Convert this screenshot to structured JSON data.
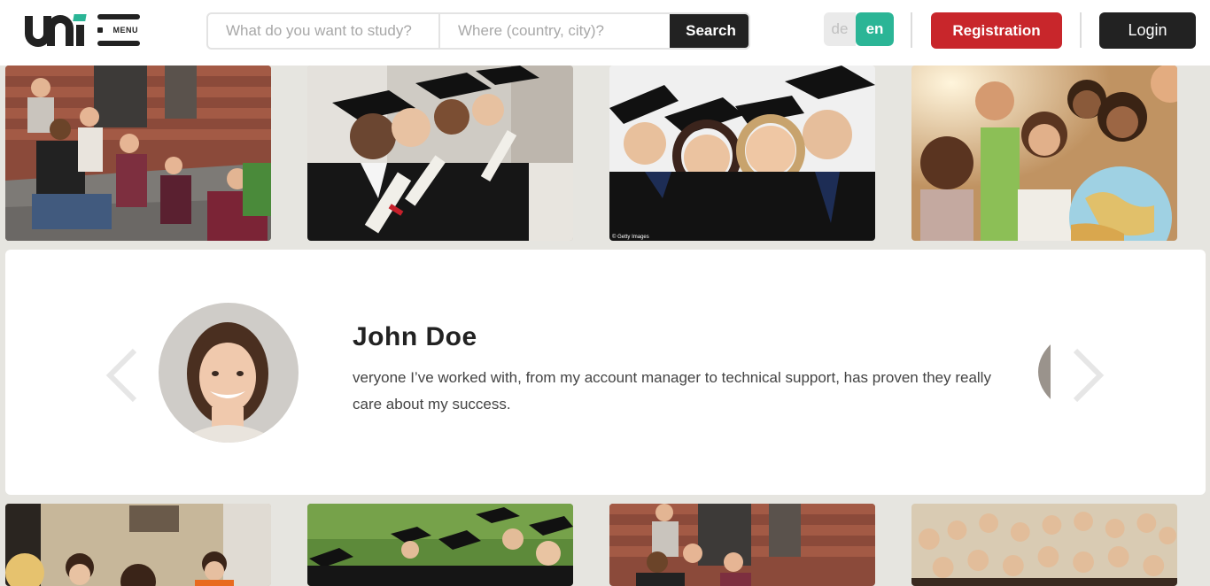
{
  "header": {
    "logo_alt": "uni",
    "menu_label": "MENU",
    "search": {
      "what_placeholder": "What do you want to study?",
      "where_placeholder": "Where (country, city)?",
      "button_label": "Search"
    },
    "languages": [
      "de",
      "en"
    ],
    "active_language": "en",
    "registration_label": "Registration",
    "login_label": "Login"
  },
  "gallery_top": [
    {
      "caption": "Students sitting on steps"
    },
    {
      "caption": "Graduates holding diplomas"
    },
    {
      "caption": "Graduates smiling",
      "credit": "© Getty Images"
    },
    {
      "caption": "Students looking at a globe"
    }
  ],
  "testimonial": {
    "name": "John Doe",
    "text": "veryone I’ve worked with, from my account manager to technical support, has proven they really care about my success."
  },
  "gallery_bottom": [
    {
      "caption": "Students in classroom"
    },
    {
      "caption": "Graduates on lawn"
    },
    {
      "caption": "Students sitting on steps"
    },
    {
      "caption": "Group of students"
    }
  ],
  "colors": {
    "accent_green": "#2bb596",
    "registration_red": "#c8262b",
    "dark": "#222222",
    "background": "#e6e5e0"
  }
}
